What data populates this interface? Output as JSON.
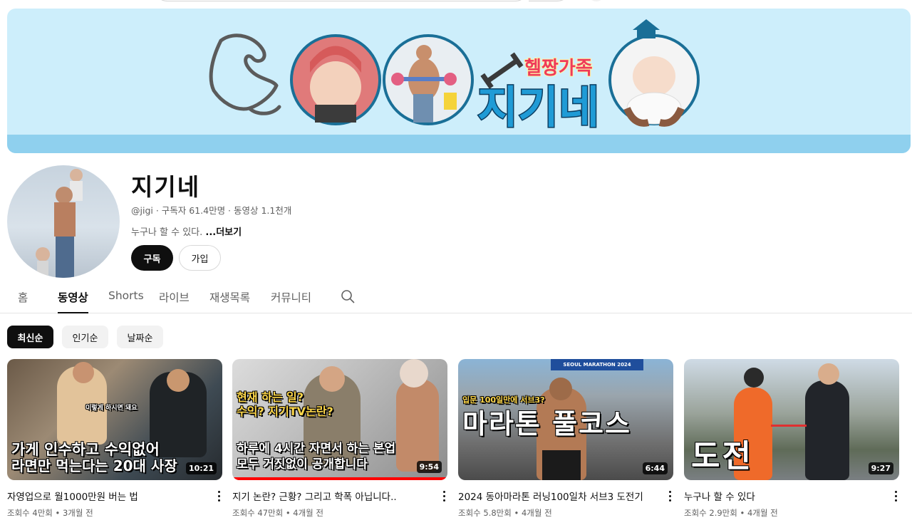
{
  "banner": {
    "logo_small": "헬짱가족",
    "logo_big": "지기네"
  },
  "channel": {
    "name": "지기네",
    "meta": "@jigi · 구독자 61.4만명 · 동영상 1.1천개",
    "description": "누구나 할 수 있다. ",
    "more_label": "...더보기",
    "subscribe_label": "구독",
    "join_label": "가입"
  },
  "tabs": [
    {
      "label": "홈"
    },
    {
      "label": "동영상"
    },
    {
      "label": "Shorts"
    },
    {
      "label": "라이브"
    },
    {
      "label": "재생목록"
    },
    {
      "label": "커뮤니티"
    }
  ],
  "chips": [
    {
      "label": "최신순"
    },
    {
      "label": "인기순"
    },
    {
      "label": "날짜순"
    }
  ],
  "videos": [
    {
      "title": "자영업으로 월1000만원 버는 법",
      "stats": "조회수 4만회 • 3개월 전",
      "duration": "10:21",
      "thumb_text_1": "가게 인수하고 수익없어",
      "thumb_text_2": "라면만 먹는다는 20대 사장",
      "thumb_caption": "이렇게 하시면 돼요",
      "progress": 0
    },
    {
      "title": "지기 논란? 근황? 그리고 학폭 아닙니다..",
      "stats": "조회수 47만회 • 4개월 전",
      "duration": "9:54",
      "thumb_text_1": "현재 하는 일?",
      "thumb_text_2": "수익? 지기TV논란?",
      "thumb_text_3": "하루에 4시간 자면서 하는 본업",
      "thumb_text_4": "모두 거짓없이 공개합니다",
      "progress": 1.0
    },
    {
      "title": "2024 동아마라톤 러닝100일차 서브3 도전기",
      "stats": "조회수 5.8만회 • 4개월 전",
      "duration": "6:44",
      "thumb_text_1": "입문 100일만에 서브3?",
      "thumb_text_2": "마라톤 풀코스",
      "thumb_sign": "SEOUL MARATHON 2024",
      "progress": 0
    },
    {
      "title": "누구나 할 수 있다",
      "stats": "조회수 2.9만회 • 4개월 전",
      "duration": "9:27",
      "thumb_text_1": "도전",
      "progress": 0
    }
  ]
}
